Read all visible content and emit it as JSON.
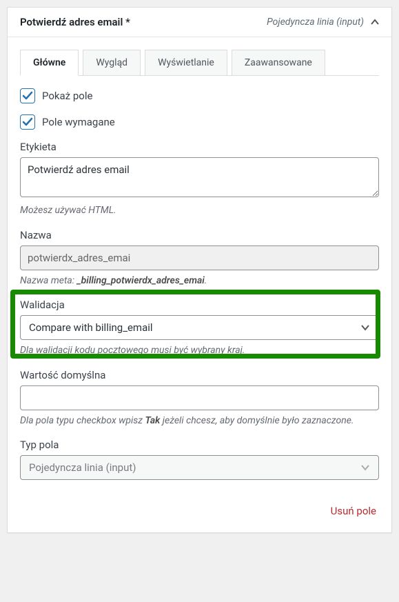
{
  "header": {
    "title": "Potwierdź adres email *",
    "type_hint": "Pojedyncza linia (input)"
  },
  "tabs": {
    "main": "Główne",
    "appearance": "Wygląd",
    "display": "Wyświetlanie",
    "advanced": "Zaawansowane"
  },
  "main": {
    "show_field_label": "Pokaż pole",
    "required_label": "Pole wymagane",
    "etykieta_label": "Etykieta",
    "etykieta_value": "Potwierdź adres email",
    "etykieta_help": "Możesz używać HTML.",
    "nazwa_label": "Nazwa",
    "nazwa_value": "potwierdx_adres_emai",
    "nazwa_meta_prefix": "Nazwa meta: ",
    "nazwa_meta_value": "_billing_potwierdx_adres_emai",
    "walidacja_label": "Walidacja",
    "walidacja_value": "Compare with billing_email",
    "walidacja_help": "Dla walidacji kodu pocztowego musi być wybrany kraj.",
    "default_label": "Wartość domyślna",
    "default_value": "",
    "default_help_prefix": "Dla pola typu checkbox wpisz ",
    "default_help_bold": "Tak",
    "default_help_suffix": " jeżeli chcesz, aby domyślnie było zaznaczone.",
    "type_label": "Typ pola",
    "type_value": "Pojedyncza linia (input)"
  },
  "footer": {
    "delete": "Usuń pole"
  }
}
